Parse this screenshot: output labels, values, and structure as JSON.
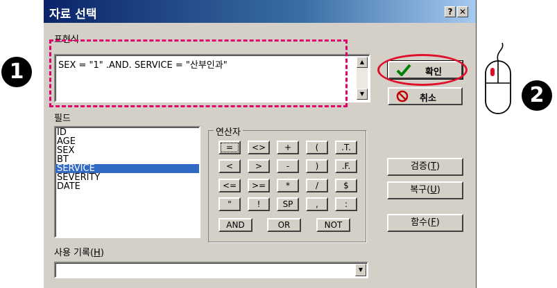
{
  "window": {
    "title": "자료 선택",
    "help_label": "?",
    "close_label": "✕"
  },
  "expression": {
    "label": "표현식",
    "value": "SEX = \"1\"  .AND. SERVICE = \"산부인과\""
  },
  "buttons": {
    "ok_label": "확인",
    "cancel_label": "취소",
    "verify_prefix": "검증(",
    "verify_key": "T",
    "verify_suffix": ")",
    "restore_prefix": "복구(",
    "restore_key": "U",
    "restore_suffix": ")",
    "function_prefix": "함수(",
    "function_key": "F",
    "function_suffix": ")"
  },
  "fields": {
    "label": "필드",
    "items": [
      "ID",
      "AGE",
      "SEX",
      "BT",
      "SERVICE",
      "SEVERITY",
      "DATE"
    ],
    "selected": "SERVICE"
  },
  "operators": {
    "label": "연산자",
    "rows": [
      [
        "=",
        "<>",
        "+",
        "(",
        ".T."
      ],
      [
        "<",
        ">",
        "-",
        ")",
        ".F."
      ],
      [
        "<=",
        ">=",
        "*",
        "/",
        "$"
      ],
      [
        "\"",
        "!",
        "SP",
        ",",
        ":"
      ]
    ],
    "logical": [
      "AND",
      "OR",
      "NOT"
    ]
  },
  "history": {
    "prefix": "사용 기록(",
    "key": "H",
    "suffix": ")",
    "value": "",
    "dropdown_glyph": "▼"
  },
  "annotations": {
    "step1": "1",
    "step2": "2",
    "highlight_color": "#e0006a",
    "step_color": "#000000"
  },
  "colors": {
    "title_start": "#0a246a",
    "title_end": "#a6caf0",
    "selection": "#316ac5",
    "dialog_face": "#d4d0c8"
  }
}
